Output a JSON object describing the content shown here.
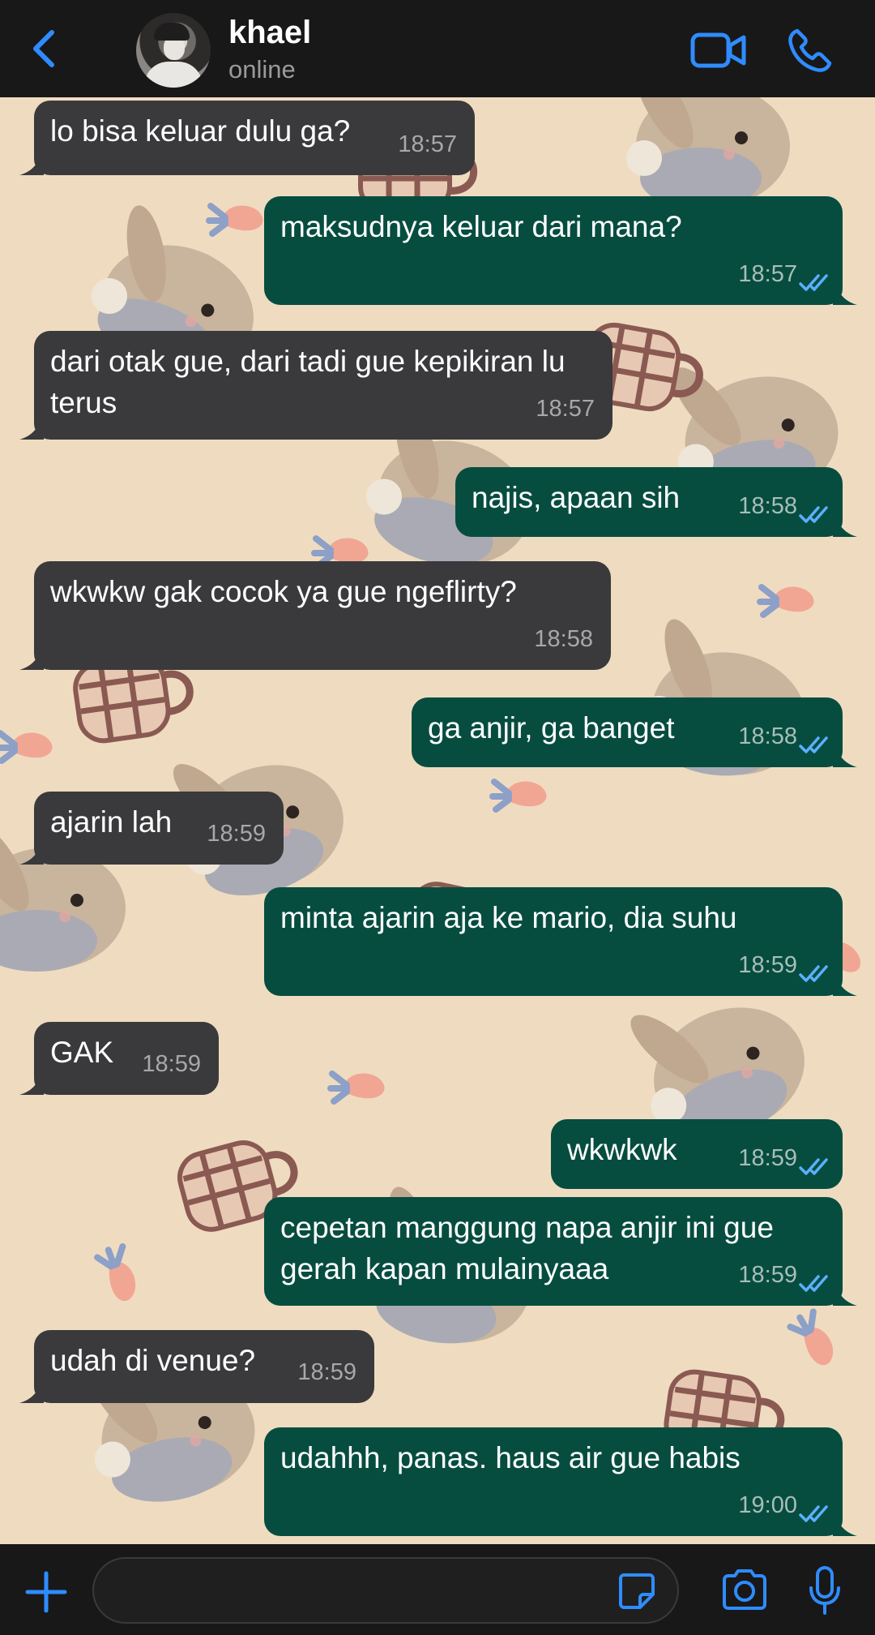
{
  "header": {
    "contact_name": "khael",
    "status": "online"
  },
  "icons": {
    "back": "chevron-left-icon",
    "video": "video-camera-icon",
    "call": "phone-icon",
    "add": "plus-icon",
    "sticker": "sticker-icon",
    "camera": "camera-icon",
    "mic": "microphone-icon",
    "read": "double-check-icon"
  },
  "colors": {
    "accent": "#2f8cff",
    "incoming_bubble": "#3a3a3c",
    "outgoing_bubble": "#064d40",
    "read_ticks": "#5ab0ff",
    "wallpaper": "#efdcc0"
  },
  "messages": [
    {
      "direction": "in",
      "text": "lo bisa keluar dulu ga?",
      "time": "18:57"
    },
    {
      "direction": "out",
      "text": "maksudnya keluar dari mana?",
      "time": "18:57",
      "read": true
    },
    {
      "direction": "in",
      "text": "dari otak gue, dari tadi gue kepikiran lu terus",
      "time": "18:57"
    },
    {
      "direction": "out",
      "text": "najis, apaan sih",
      "time": "18:58",
      "read": true
    },
    {
      "direction": "in",
      "text": "wkwkw gak cocok ya gue ngeflirty?",
      "time": "18:58"
    },
    {
      "direction": "out",
      "text": "ga anjir, ga banget",
      "time": "18:58",
      "read": true
    },
    {
      "direction": "in",
      "text": "ajarin lah",
      "time": "18:59"
    },
    {
      "direction": "out",
      "text": "minta ajarin aja ke mario, dia suhu",
      "time": "18:59",
      "read": true
    },
    {
      "direction": "in",
      "text": "GAK",
      "time": "18:59"
    },
    {
      "direction": "out",
      "text": "wkwkwk",
      "time": "18:59",
      "read": true
    },
    {
      "direction": "out",
      "text": "cepetan manggung napa anjir ini gue gerah kapan mulainyaaa",
      "time": "18:59",
      "read": true
    },
    {
      "direction": "in",
      "text": "udah di venue?",
      "time": "18:59"
    },
    {
      "direction": "out",
      "text": "udahhh, panas. haus air gue habis",
      "time": "19:00",
      "read": true
    }
  ],
  "composer": {
    "value": "",
    "placeholder": ""
  }
}
